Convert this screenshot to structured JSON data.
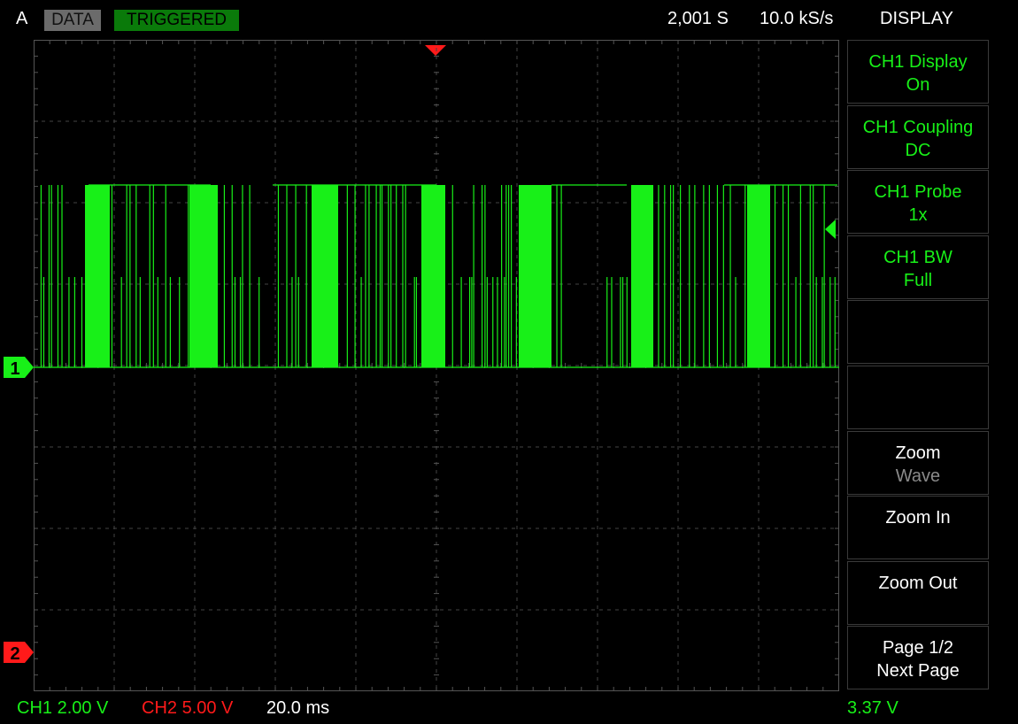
{
  "status": {
    "mode": "A",
    "data_label": "DATA",
    "trigger_state": "TRIGGERED",
    "record_length": "2,001 S",
    "sample_rate": "10.0 kS/s",
    "menu_title": "DISPLAY"
  },
  "menu": [
    {
      "line1": "CH1 Display",
      "line2": "On",
      "color": "#18f018"
    },
    {
      "line1": "CH1 Coupling",
      "line2": "DC",
      "color": "#18f018"
    },
    {
      "line1": "CH1 Probe",
      "line2": "1x",
      "color": "#18f018"
    },
    {
      "line1": "CH1 BW",
      "line2": "Full",
      "color": "#18f018"
    },
    {
      "line1": "",
      "line2": "",
      "color": "#ffffff"
    },
    {
      "line1": "",
      "line2": "",
      "color": "#ffffff"
    },
    {
      "line1": "Zoom",
      "line2": "Wave",
      "color": "#ffffff",
      "line2_disabled": true
    },
    {
      "line1": "Zoom In",
      "line2": "",
      "color": "#ffffff"
    },
    {
      "line1": "Zoom Out",
      "line2": "",
      "color": "#ffffff"
    },
    {
      "line1": "Page 1/2",
      "line2": "Next Page",
      "color": "#ffffff"
    }
  ],
  "channels": {
    "ch1_marker": "1",
    "ch2_marker": "2",
    "ch1_scale": "CH1 2.00 V",
    "ch2_scale": "CH2 5.00 V",
    "timebase": "20.0 ms",
    "trigger_level": "3.37 V",
    "ch1_color": "#18f018",
    "ch2_color": "#ff1a1a"
  }
}
